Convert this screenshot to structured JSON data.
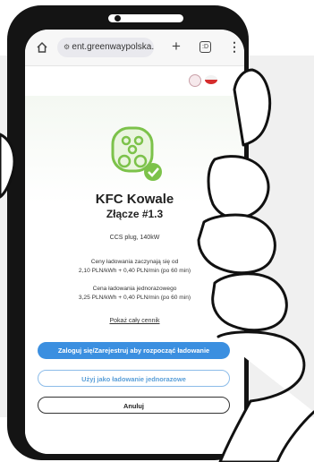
{
  "browser": {
    "url": "ent.greenwaypolska.pl",
    "plus_symbol": "+",
    "tab_count": ":D",
    "menu_symbol": "⋮",
    "icons": [
      "home-icon",
      "site-settings-icon",
      "new-tab-icon",
      "tabs-icon",
      "menu-icon"
    ]
  },
  "language": {
    "icons": [
      "globe-icon",
      "polish-flag-icon"
    ]
  },
  "station": {
    "name": "KFC Kowale",
    "connector": "Złącze #1.3",
    "plug": "CCS plug, 140kW",
    "price_intro": "Ceny ładowania zaczynają się od",
    "price_from": "2,10 PLN/kWh + 0,40 PLN/min (po 60 min)",
    "single_title": "Cena ładowania jednorazowego",
    "single_price": "3,25 PLN/kWh + 0,40 PLN/min (po 60 min)",
    "price_link": "Pokaż cały cennik"
  },
  "buttons": {
    "login": "Zaloguj się/Zarejestruj aby rozpocząć ładowanie",
    "single": "Użyj jako ładowanie jednorazowe",
    "cancel": "Anuluj"
  },
  "colors": {
    "accent": "#3b8fe0",
    "charger_green": "#7cc24a",
    "flag_red": "#d52d2d"
  }
}
